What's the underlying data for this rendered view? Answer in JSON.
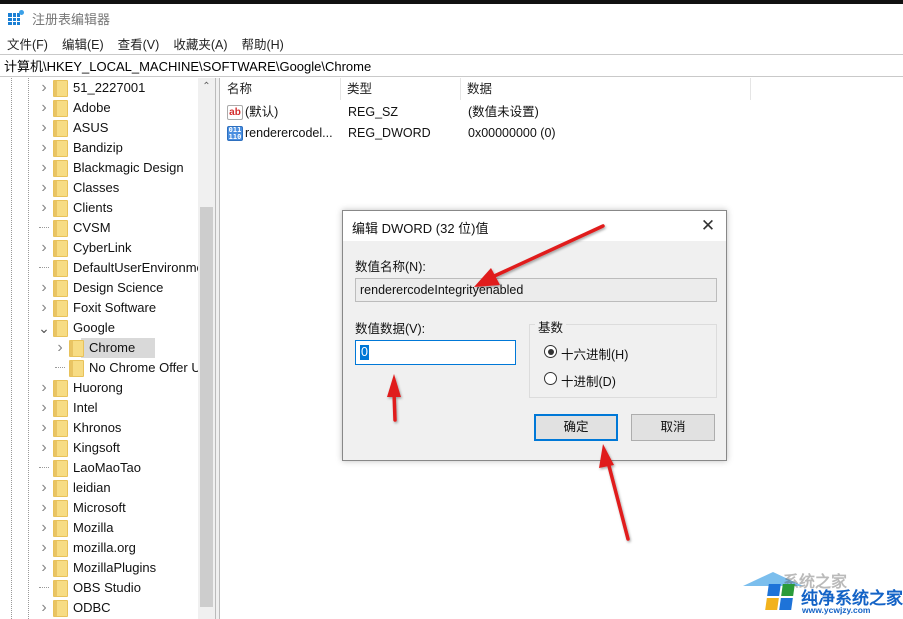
{
  "window": {
    "title": "注册表编辑器",
    "icon": "regedit-icon"
  },
  "menu": [
    "文件(F)",
    "编辑(E)",
    "查看(V)",
    "收藏夹(A)",
    "帮助(H)"
  ],
  "address": "计算机\\HKEY_LOCAL_MACHINE\\SOFTWARE\\Google\\Chrome",
  "tree": {
    "items": [
      {
        "label": "51_2227001",
        "level": 1,
        "expander": "collapsed"
      },
      {
        "label": "Adobe",
        "level": 1,
        "expander": "collapsed"
      },
      {
        "label": "ASUS",
        "level": 1,
        "expander": "collapsed"
      },
      {
        "label": "Bandizip",
        "level": 1,
        "expander": "collapsed"
      },
      {
        "label": "Blackmagic Design",
        "level": 1,
        "expander": "collapsed"
      },
      {
        "label": "Classes",
        "level": 1,
        "expander": "collapsed"
      },
      {
        "label": "Clients",
        "level": 1,
        "expander": "collapsed"
      },
      {
        "label": "CVSM",
        "level": 1,
        "expander": "none"
      },
      {
        "label": "CyberLink",
        "level": 1,
        "expander": "collapsed"
      },
      {
        "label": "DefaultUserEnvironment",
        "level": 1,
        "expander": "none"
      },
      {
        "label": "Design Science",
        "level": 1,
        "expander": "collapsed"
      },
      {
        "label": "Foxit Software",
        "level": 1,
        "expander": "collapsed"
      },
      {
        "label": "Google",
        "level": 1,
        "expander": "expanded"
      },
      {
        "label": "Chrome",
        "level": 2,
        "expander": "collapsed",
        "selected": true
      },
      {
        "label": "No Chrome Offer Until",
        "level": 2,
        "expander": "none"
      },
      {
        "label": "Huorong",
        "level": 1,
        "expander": "collapsed"
      },
      {
        "label": "Intel",
        "level": 1,
        "expander": "collapsed"
      },
      {
        "label": "Khronos",
        "level": 1,
        "expander": "collapsed"
      },
      {
        "label": "Kingsoft",
        "level": 1,
        "expander": "collapsed"
      },
      {
        "label": "LaoMaoTao",
        "level": 1,
        "expander": "none"
      },
      {
        "label": "leidian",
        "level": 1,
        "expander": "collapsed"
      },
      {
        "label": "Microsoft",
        "level": 1,
        "expander": "collapsed"
      },
      {
        "label": "Mozilla",
        "level": 1,
        "expander": "collapsed"
      },
      {
        "label": "mozilla.org",
        "level": 1,
        "expander": "collapsed"
      },
      {
        "label": "MozillaPlugins",
        "level": 1,
        "expander": "collapsed"
      },
      {
        "label": "OBS Studio",
        "level": 1,
        "expander": "none"
      },
      {
        "label": "ODBC",
        "level": 1,
        "expander": "collapsed"
      }
    ]
  },
  "list": {
    "columns": [
      "名称",
      "类型",
      "数据"
    ],
    "rows": [
      {
        "icon": "string-value-icon",
        "name": "(默认)",
        "type": "REG_SZ",
        "data": "(数值未设置)"
      },
      {
        "icon": "binary-value-icon",
        "name": "renderercodel...",
        "type": "REG_DWORD",
        "data": "0x00000000 (0)"
      }
    ]
  },
  "dialog": {
    "title": "编辑 DWORD (32 位)值",
    "name_label": "数值名称(N):",
    "name_value": "renderercodeIntegrityenabled",
    "data_label": "数值数据(V):",
    "data_value": "0",
    "base_label": "基数",
    "base_options": [
      {
        "label": "十六进制(H)",
        "checked": true
      },
      {
        "label": "十进制(D)",
        "checked": false
      }
    ],
    "ok_label": "确定",
    "cancel_label": "取消"
  },
  "annotations": {
    "arrow_color": "#e01b1b",
    "arrows": [
      "pointing-to-value-name",
      "pointing-to-value-data",
      "pointing-to-ok-button"
    ]
  },
  "watermark": {
    "faded_text": "系统之家",
    "text": "纯净系统之家",
    "url": "www.ycwjzy.com",
    "colors": [
      "#1e73d8",
      "#2a9b3a",
      "#f2b21c",
      "#1e73d8"
    ]
  }
}
